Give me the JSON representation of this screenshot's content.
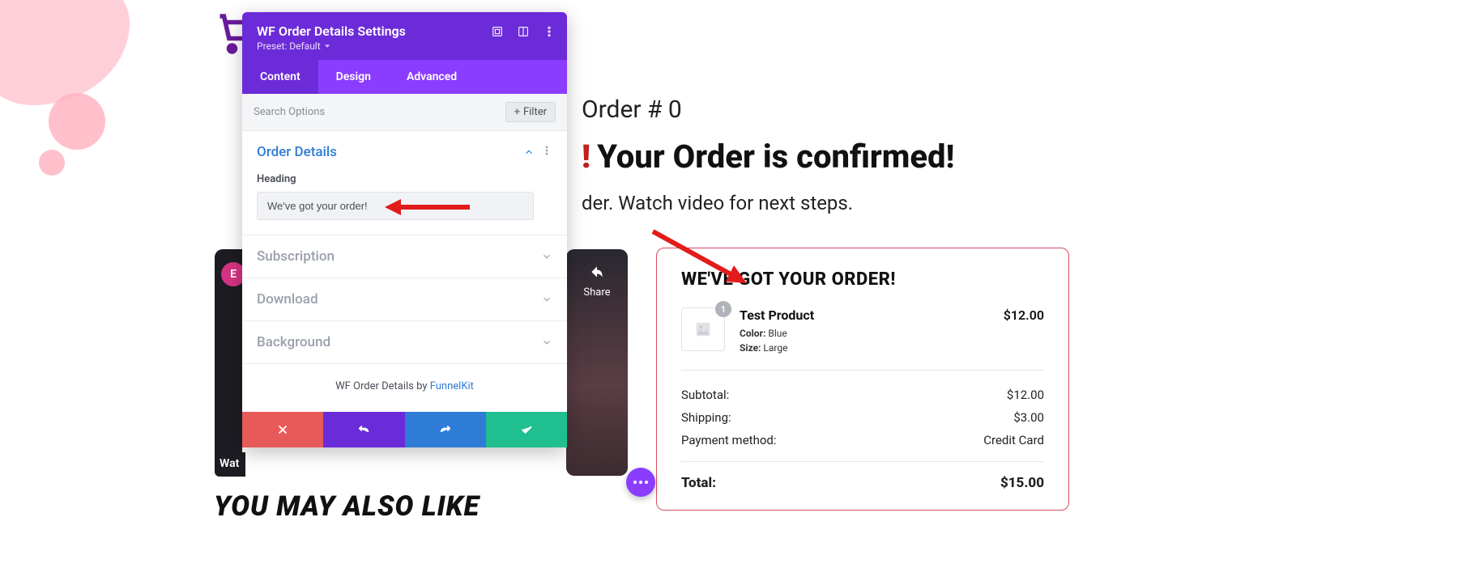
{
  "panel": {
    "title": "WF Order Details Settings",
    "preset_label": "Preset: Default",
    "tabs": {
      "content": "Content",
      "design": "Design",
      "advanced": "Advanced"
    },
    "search_placeholder": "Search Options",
    "filter_label": "Filter",
    "sections": {
      "order_details": {
        "title": "Order Details",
        "heading_label": "Heading",
        "heading_value": "We've got your order!"
      },
      "subscription": {
        "title": "Subscription"
      },
      "download": {
        "title": "Download"
      },
      "background": {
        "title": "Background"
      }
    },
    "footer": {
      "prefix": "WF Order Details by ",
      "link": "FunnelKit"
    }
  },
  "page": {
    "order_number_label": "Order # 0",
    "confirmed_bang": "!",
    "confirmed_text": "Your Order is confirmed!",
    "sub_suffix": "der. Watch video for next steps.",
    "share_label": "Share",
    "wat_label": "Wat",
    "you_may_label": "YOU MAY ALSO LIKE"
  },
  "order_card": {
    "title": "WE'VE GOT YOUR ORDER!",
    "product": {
      "name": "Test Product",
      "qty_badge": "1",
      "price": "$12.00",
      "color_label": "Color:",
      "color_value": " Blue",
      "size_label": "Size:",
      "size_value": " Large"
    },
    "totals": {
      "subtotal_label": "Subtotal:",
      "subtotal_value": "$12.00",
      "shipping_label": "Shipping:",
      "shipping_value": "$3.00",
      "payment_label": "Payment method:",
      "payment_value": "Credit Card",
      "total_label": "Total:",
      "total_value": "$15.00"
    }
  }
}
